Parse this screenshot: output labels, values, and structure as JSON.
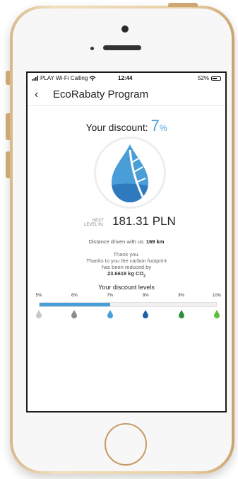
{
  "status_bar": {
    "carrier": "PLAY Wi-Fi Calling",
    "time": "12:44",
    "battery": "52%"
  },
  "header": {
    "back_icon": "chevron-left-icon",
    "title": "EcoRabaty Program"
  },
  "discount": {
    "label": "Your discount:",
    "value": "7",
    "unit": "%"
  },
  "next_level": {
    "label_line1": "NEXT",
    "label_line2": "LEVEL IN:",
    "amount": "181.31 PLN"
  },
  "distance": {
    "label": "Distance driven with us:",
    "value": "169 km"
  },
  "thanks": {
    "line1": "Thank you.",
    "line2": "Thanks to you the carbon footprint",
    "line3": "has been reduced by",
    "value": "23.6618 kg CO",
    "sub": "2"
  },
  "levels": {
    "title": "Your discount levels",
    "current_progress": 0.4,
    "items": [
      {
        "label": "5%",
        "color": "#c7c7c7"
      },
      {
        "label": "6%",
        "color": "#8b8b8b"
      },
      {
        "label": "7%",
        "color": "#4a9ed8"
      },
      {
        "label": "8%",
        "color": "#1f5fa3"
      },
      {
        "label": "9%",
        "color": "#2f8f3a"
      },
      {
        "label": "10%",
        "color": "#5fbf3f"
      }
    ]
  },
  "colors": {
    "accent": "#4a9ed8"
  }
}
